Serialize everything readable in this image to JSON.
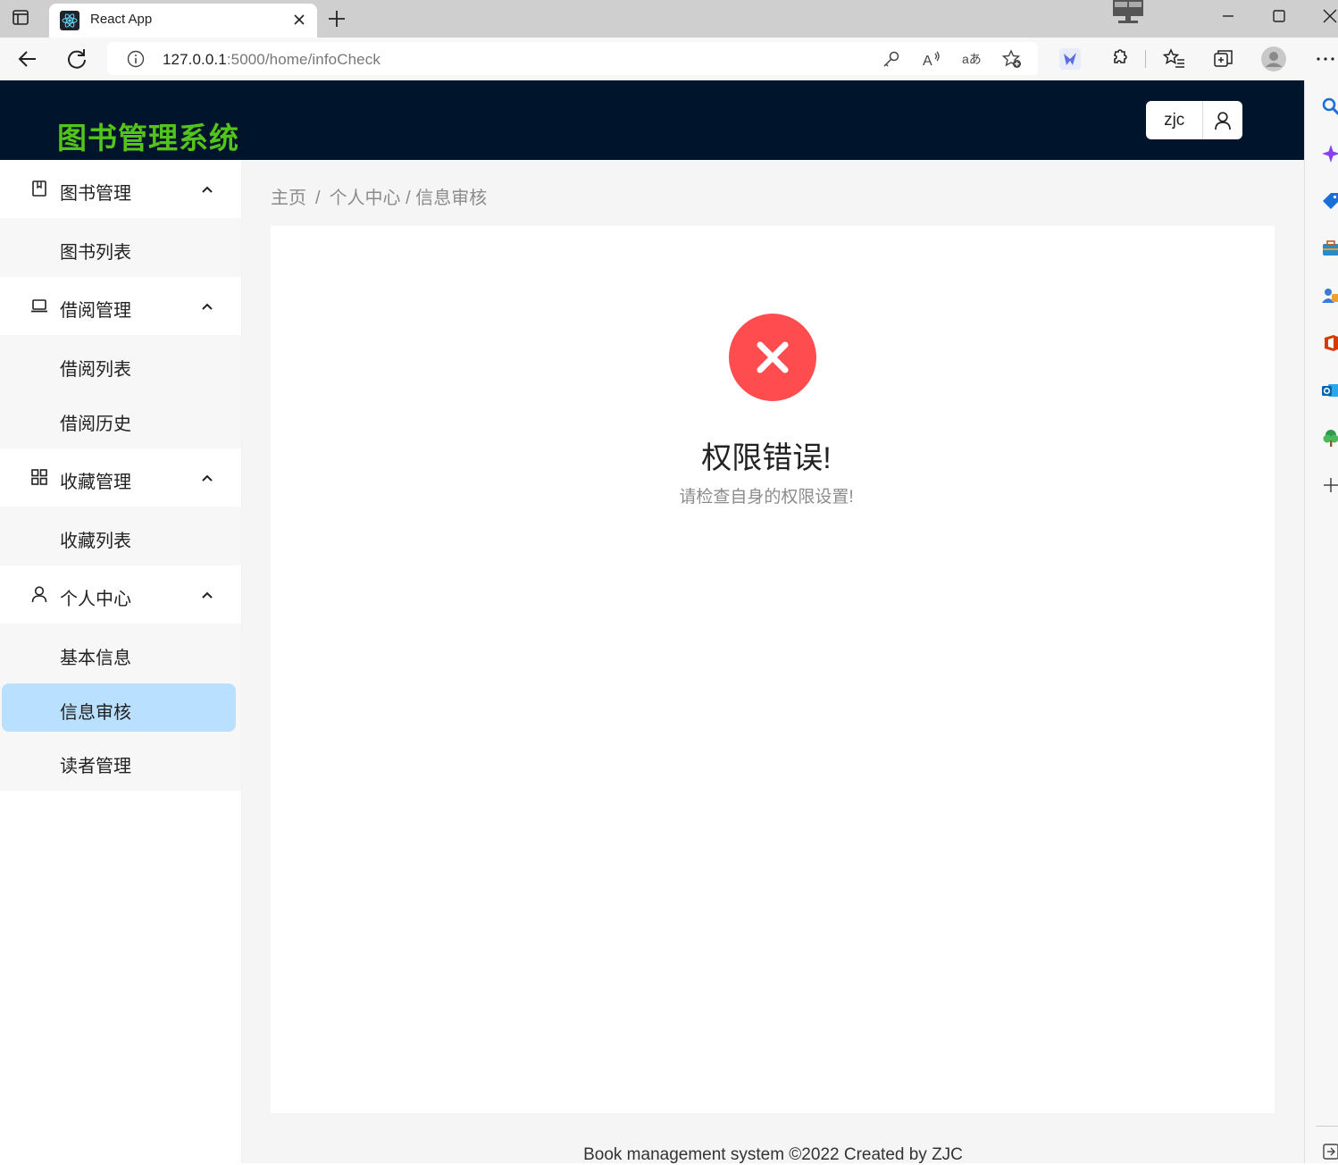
{
  "browser": {
    "tab_title": "React App",
    "url_host": "127.0.0.1",
    "url_path": ":5000/home/infoCheck"
  },
  "app": {
    "logo": "图书管理系统",
    "username": "zjc"
  },
  "sidebar": {
    "groups": [
      {
        "label": "图书管理",
        "icon": "book-icon",
        "items": [
          {
            "label": "图书列表"
          }
        ]
      },
      {
        "label": "借阅管理",
        "icon": "laptop-icon",
        "items": [
          {
            "label": "借阅列表"
          },
          {
            "label": "借阅历史"
          }
        ]
      },
      {
        "label": "收藏管理",
        "icon": "appstore-icon",
        "items": [
          {
            "label": "收藏列表"
          }
        ]
      },
      {
        "label": "个人中心",
        "icon": "user-icon",
        "items": [
          {
            "label": "基本信息"
          },
          {
            "label": "信息审核",
            "selected": true
          },
          {
            "label": "读者管理"
          }
        ]
      }
    ]
  },
  "breadcrumb": {
    "home": "主页",
    "sep": "/",
    "rest": "个人中心 / 信息审核"
  },
  "result": {
    "status": "error",
    "title": "权限错误!",
    "subtitle": "请检查自身的权限设置!"
  },
  "footer": {
    "text": "Book management system ©2022 Created by ZJC"
  },
  "colors": {
    "header_bg": "#00152b",
    "logo": "#52c41a",
    "selected_bg": "#bae0ff",
    "error": "#ff4d4f"
  }
}
